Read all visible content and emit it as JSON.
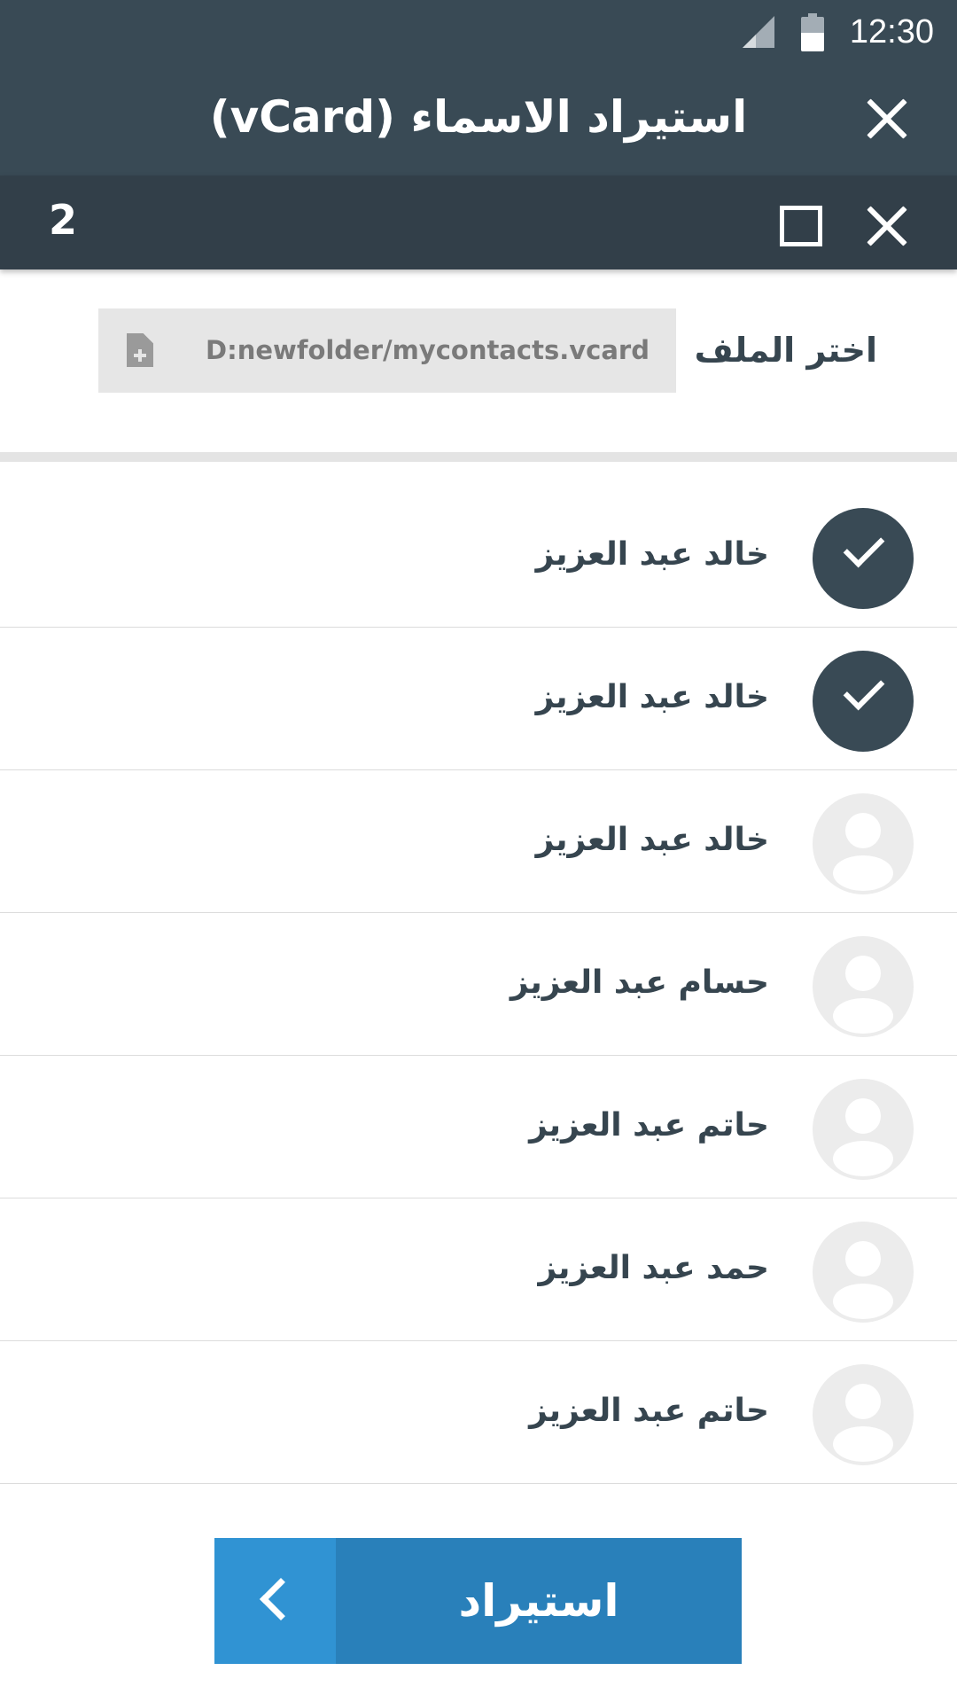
{
  "status_bar": {
    "time": "12:30",
    "icons": [
      "signal-icon",
      "battery-icon"
    ]
  },
  "header": {
    "title": "استيراد الاسماء (vCard)",
    "close_icon": "close-icon"
  },
  "selection_bar": {
    "selected_count": "2",
    "icons": [
      "maximize-icon",
      "close-icon"
    ]
  },
  "file_picker": {
    "label": "اختر الملف",
    "value": "D:newfolder/mycontacts.vcard",
    "icon": "file-add-icon"
  },
  "contacts": [
    {
      "name": "خالد عبد العزيز",
      "checked": true
    },
    {
      "name": "خالد عبد العزيز",
      "checked": true
    },
    {
      "name": "خالد عبد العزيز",
      "checked": false
    },
    {
      "name": "حسام عبد العزيز",
      "checked": false
    },
    {
      "name": "حاتم عبد العزيز",
      "checked": false
    },
    {
      "name": "حمد عبد العزيز",
      "checked": false
    },
    {
      "name": "حاتم عبد العزيز",
      "checked": false
    }
  ],
  "import_button": {
    "label": "استيراد",
    "icon": "chevron-left-icon"
  },
  "colors": {
    "header": "#394a55",
    "subbar": "#323f49",
    "button": "#2980ba",
    "button_accent": "#3093d3"
  }
}
